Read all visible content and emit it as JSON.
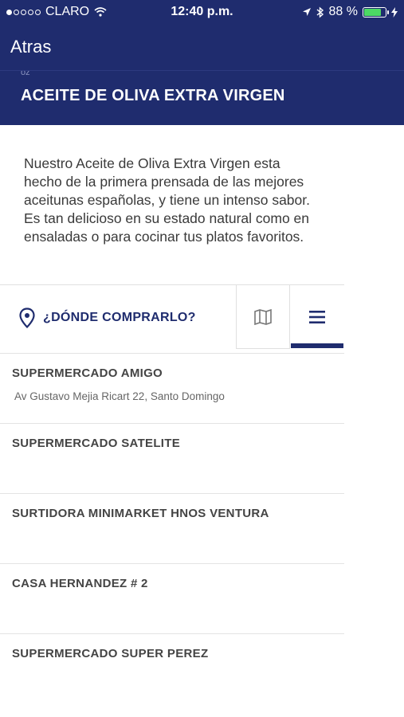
{
  "status_bar": {
    "carrier": "CLARO",
    "time": "12:40 p.m.",
    "battery": "88 %",
    "battery_level": 0.88
  },
  "nav": {
    "back_label": "Atras"
  },
  "header": {
    "faded_text": "oz",
    "title": "ACEITE DE OLIVA EXTRA VIRGEN"
  },
  "description": "Nuestro Aceite de Oliva Extra Virgen esta hecho de la primera prensada de las mejores aceitunas españolas, y tiene un intenso sabor. Es tan delicioso en su estado natural como en ensaladas o para cocinar tus platos favoritos.",
  "where_to_buy": {
    "label": "¿DÓNDE COMPRARLO?",
    "icons": [
      "location-pin-icon",
      "map-icon",
      "list-icon"
    ]
  },
  "stores": [
    {
      "name": "SUPERMERCADO AMIGO",
      "address": "Av Gustavo Mejia Ricart 22, Santo Domingo"
    },
    {
      "name": "SUPERMERCADO SATELITE",
      "address": ""
    },
    {
      "name": "SURTIDORA MINIMARKET HNOS VENTURA",
      "address": ""
    },
    {
      "name": "CASA HERNANDEZ # 2",
      "address": ""
    },
    {
      "name": "SUPERMERCADO SUPER PEREZ",
      "address": ""
    }
  ],
  "colors": {
    "brand": "#1f2c6e",
    "battery": "#4cd964"
  }
}
